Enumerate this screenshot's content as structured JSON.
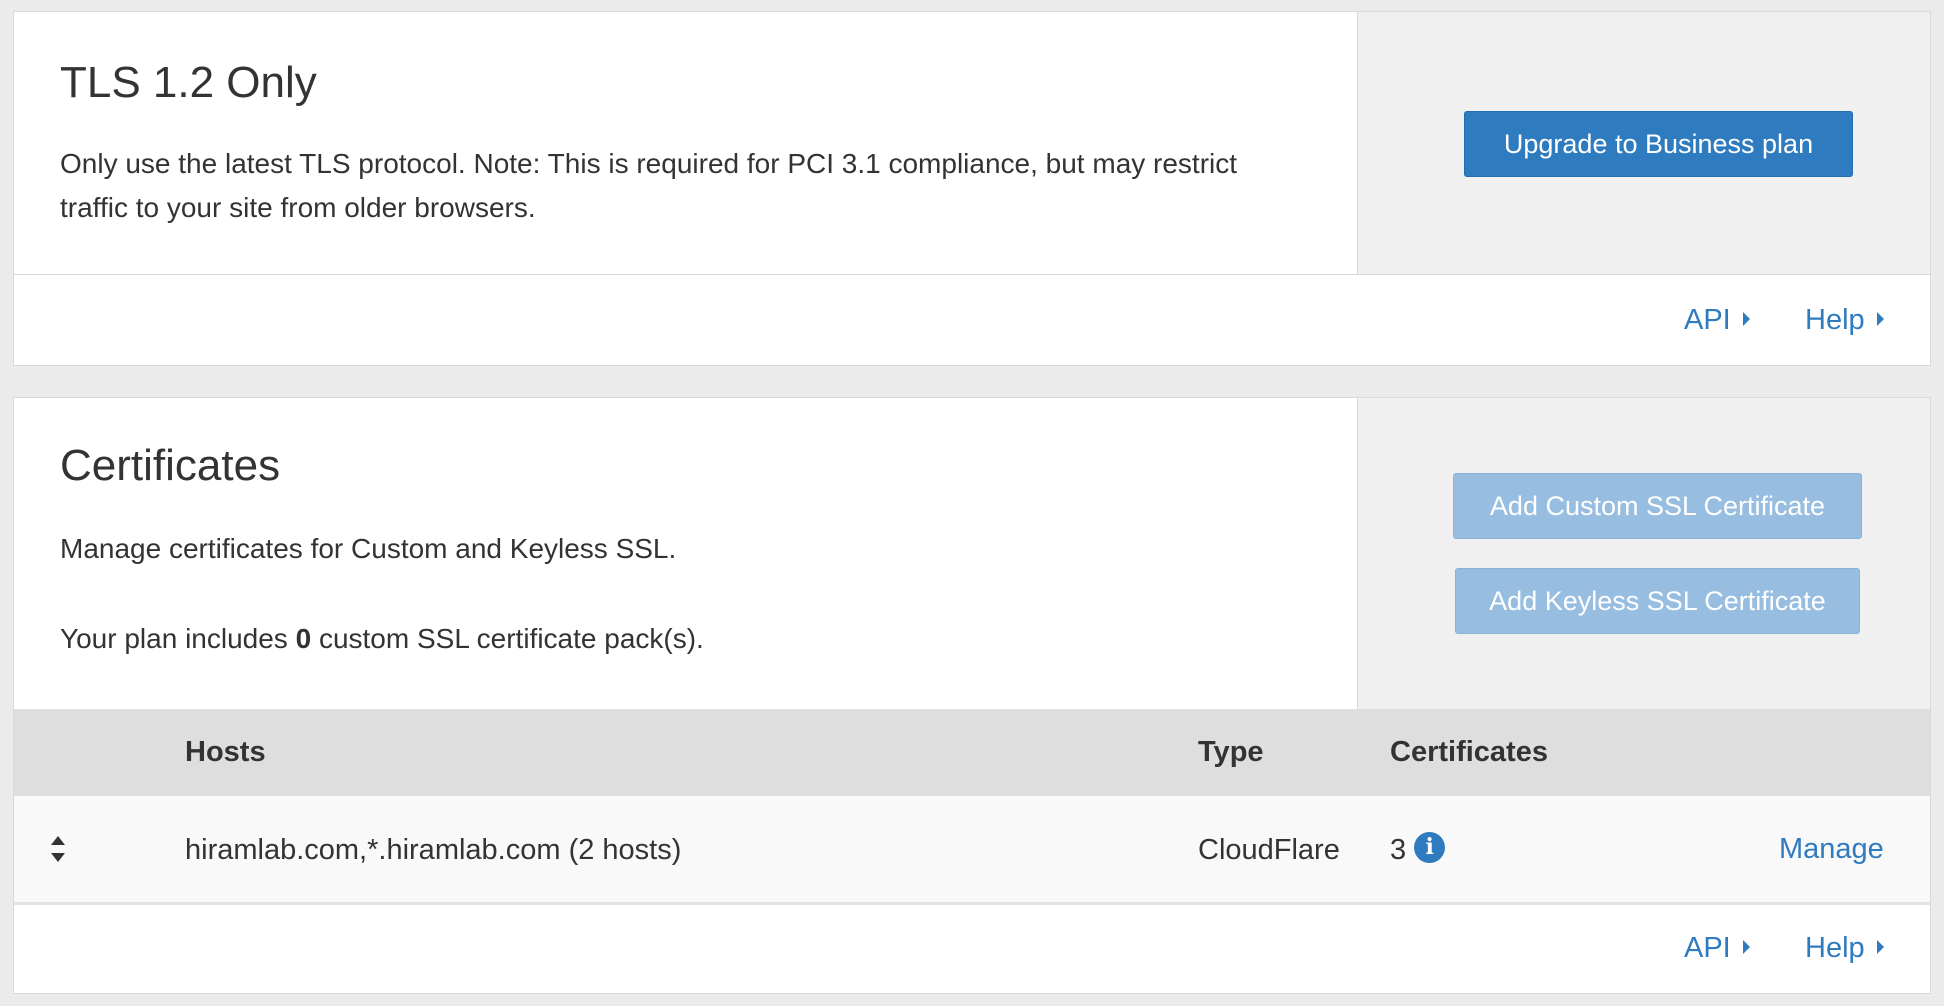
{
  "tls": {
    "title": "TLS 1.2 Only",
    "description": "Only use the latest TLS protocol. Note: This is required for PCI 3.1 compliance, but may restrict traffic to your site from older browsers.",
    "upgrade_button": "Upgrade to Business plan",
    "footer": {
      "api_label": "API",
      "help_label": "Help"
    }
  },
  "certificates": {
    "title": "Certificates",
    "description": "Manage certificates for Custom and Keyless SSL.",
    "plan_prefix": "Your plan includes",
    "plan_count": "0",
    "plan_suffix": "custom SSL certificate pack(s).",
    "add_custom_button": "Add Custom SSL Certificate",
    "add_keyless_button": "Add Keyless SSL Certificate",
    "table": {
      "headers": {
        "hosts": "Hosts",
        "type": "Type",
        "certificates": "Certificates"
      },
      "rows": [
        {
          "hosts": "hiramlab.com,*.hiramlab.com (2 hosts)",
          "type": "CloudFlare",
          "certificates": "3",
          "action": "Manage"
        }
      ]
    },
    "footer": {
      "api_label": "API",
      "help_label": "Help"
    }
  },
  "icons": {
    "caret": "caret-right-icon",
    "sort": "sort-icon",
    "info": "info-icon"
  },
  "colors": {
    "accent": "#2f7bbf",
    "disabled_button": "#97bde0",
    "table_header": "#dedede",
    "side_panel": "#f0f0f0"
  }
}
